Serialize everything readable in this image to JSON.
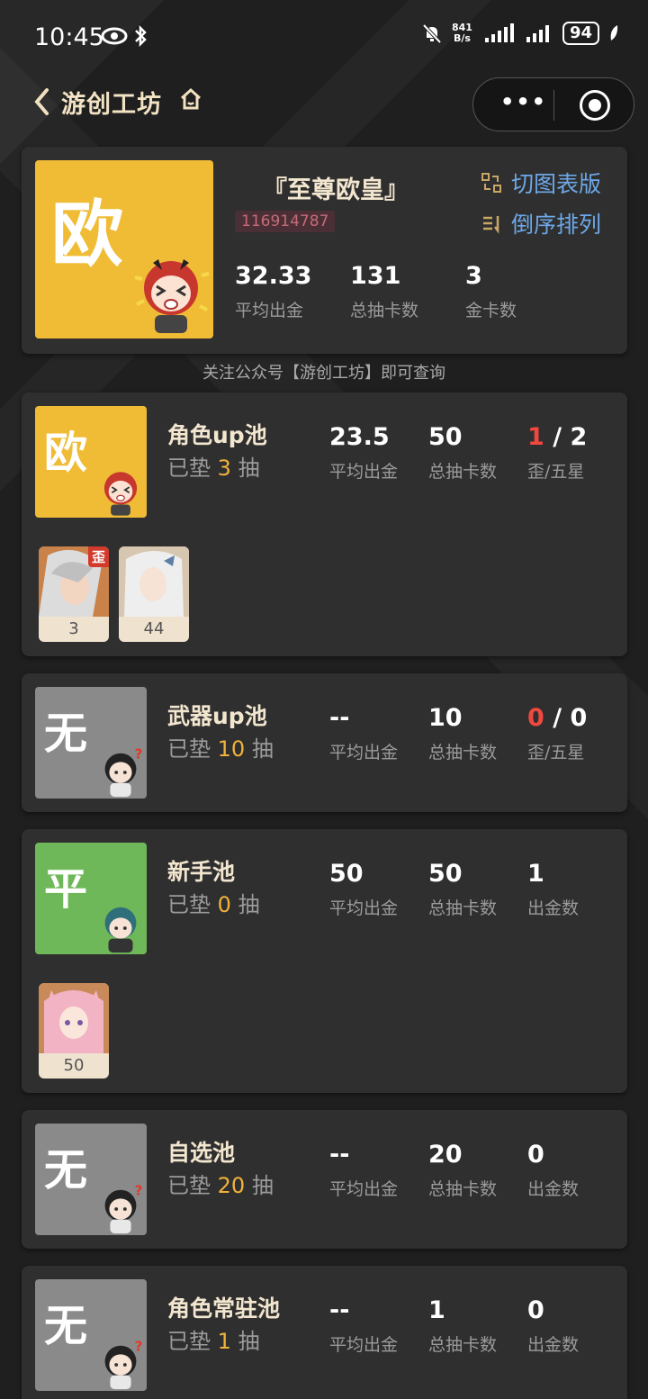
{
  "status": {
    "time": "10:45",
    "netspeed_value": "841",
    "netspeed_unit": "B/s",
    "battery": "94"
  },
  "nav": {
    "back": "‹",
    "title": "游创工坊",
    "more": "•••"
  },
  "summary": {
    "badge": "欧",
    "name": "『至尊欧皇』",
    "uid": "116914787",
    "switch_label": "切图表版",
    "sort_label": "倒序排列",
    "stats": [
      {
        "value": "32.33",
        "label": "平均出金"
      },
      {
        "value": "131",
        "label": "总抽卡数"
      },
      {
        "value": "3",
        "label": "金卡数"
      }
    ]
  },
  "hint": "关注公众号【游创工坊】即可查询",
  "pools": [
    {
      "badge": "欧",
      "badge_color": "#f0bc36",
      "name": "角色up池",
      "pity_prefix": "已垫",
      "pity": "3",
      "pity_suffix": "抽",
      "avg": "23.5",
      "avg_label": "平均出金",
      "total": "50",
      "total_label": "总抽卡数",
      "third_red": "1",
      "third_sep": " / ",
      "third_rest": "2",
      "third_label": "歪/五星",
      "chars": [
        {
          "count": "3",
          "tag": "歪"
        },
        {
          "count": "44",
          "tag": ""
        }
      ]
    },
    {
      "badge": "无",
      "badge_color": "#8a8a8a",
      "name": "武器up池",
      "pity_prefix": "已垫",
      "pity": "10",
      "pity_suffix": "抽",
      "avg": "--",
      "avg_label": "平均出金",
      "total": "10",
      "total_label": "总抽卡数",
      "third_red": "0",
      "third_sep": " / ",
      "third_rest": "0",
      "third_label": "歪/五星"
    },
    {
      "badge": "平",
      "badge_color": "#6fb859",
      "name": "新手池",
      "pity_prefix": "已垫",
      "pity": "0",
      "pity_suffix": "抽",
      "avg": "50",
      "avg_label": "平均出金",
      "total": "50",
      "total_label": "总抽卡数",
      "third_red": "",
      "third_sep": "",
      "third_rest": "1",
      "third_label": "出金数",
      "chars": [
        {
          "count": "50",
          "tag": ""
        }
      ]
    },
    {
      "badge": "无",
      "badge_color": "#8a8a8a",
      "name": "自选池",
      "pity_prefix": "已垫",
      "pity": "20",
      "pity_suffix": "抽",
      "avg": "--",
      "avg_label": "平均出金",
      "total": "20",
      "total_label": "总抽卡数",
      "third_red": "",
      "third_sep": "",
      "third_rest": "0",
      "third_label": "出金数"
    },
    {
      "badge": "无",
      "badge_color": "#8a8a8a",
      "name": "角色常驻池",
      "pity_prefix": "已垫",
      "pity": "1",
      "pity_suffix": "抽",
      "avg": "--",
      "avg_label": "平均出金",
      "total": "1",
      "total_label": "总抽卡数",
      "third_red": "",
      "third_sep": "",
      "third_rest": "0",
      "third_label": "出金数"
    }
  ]
}
